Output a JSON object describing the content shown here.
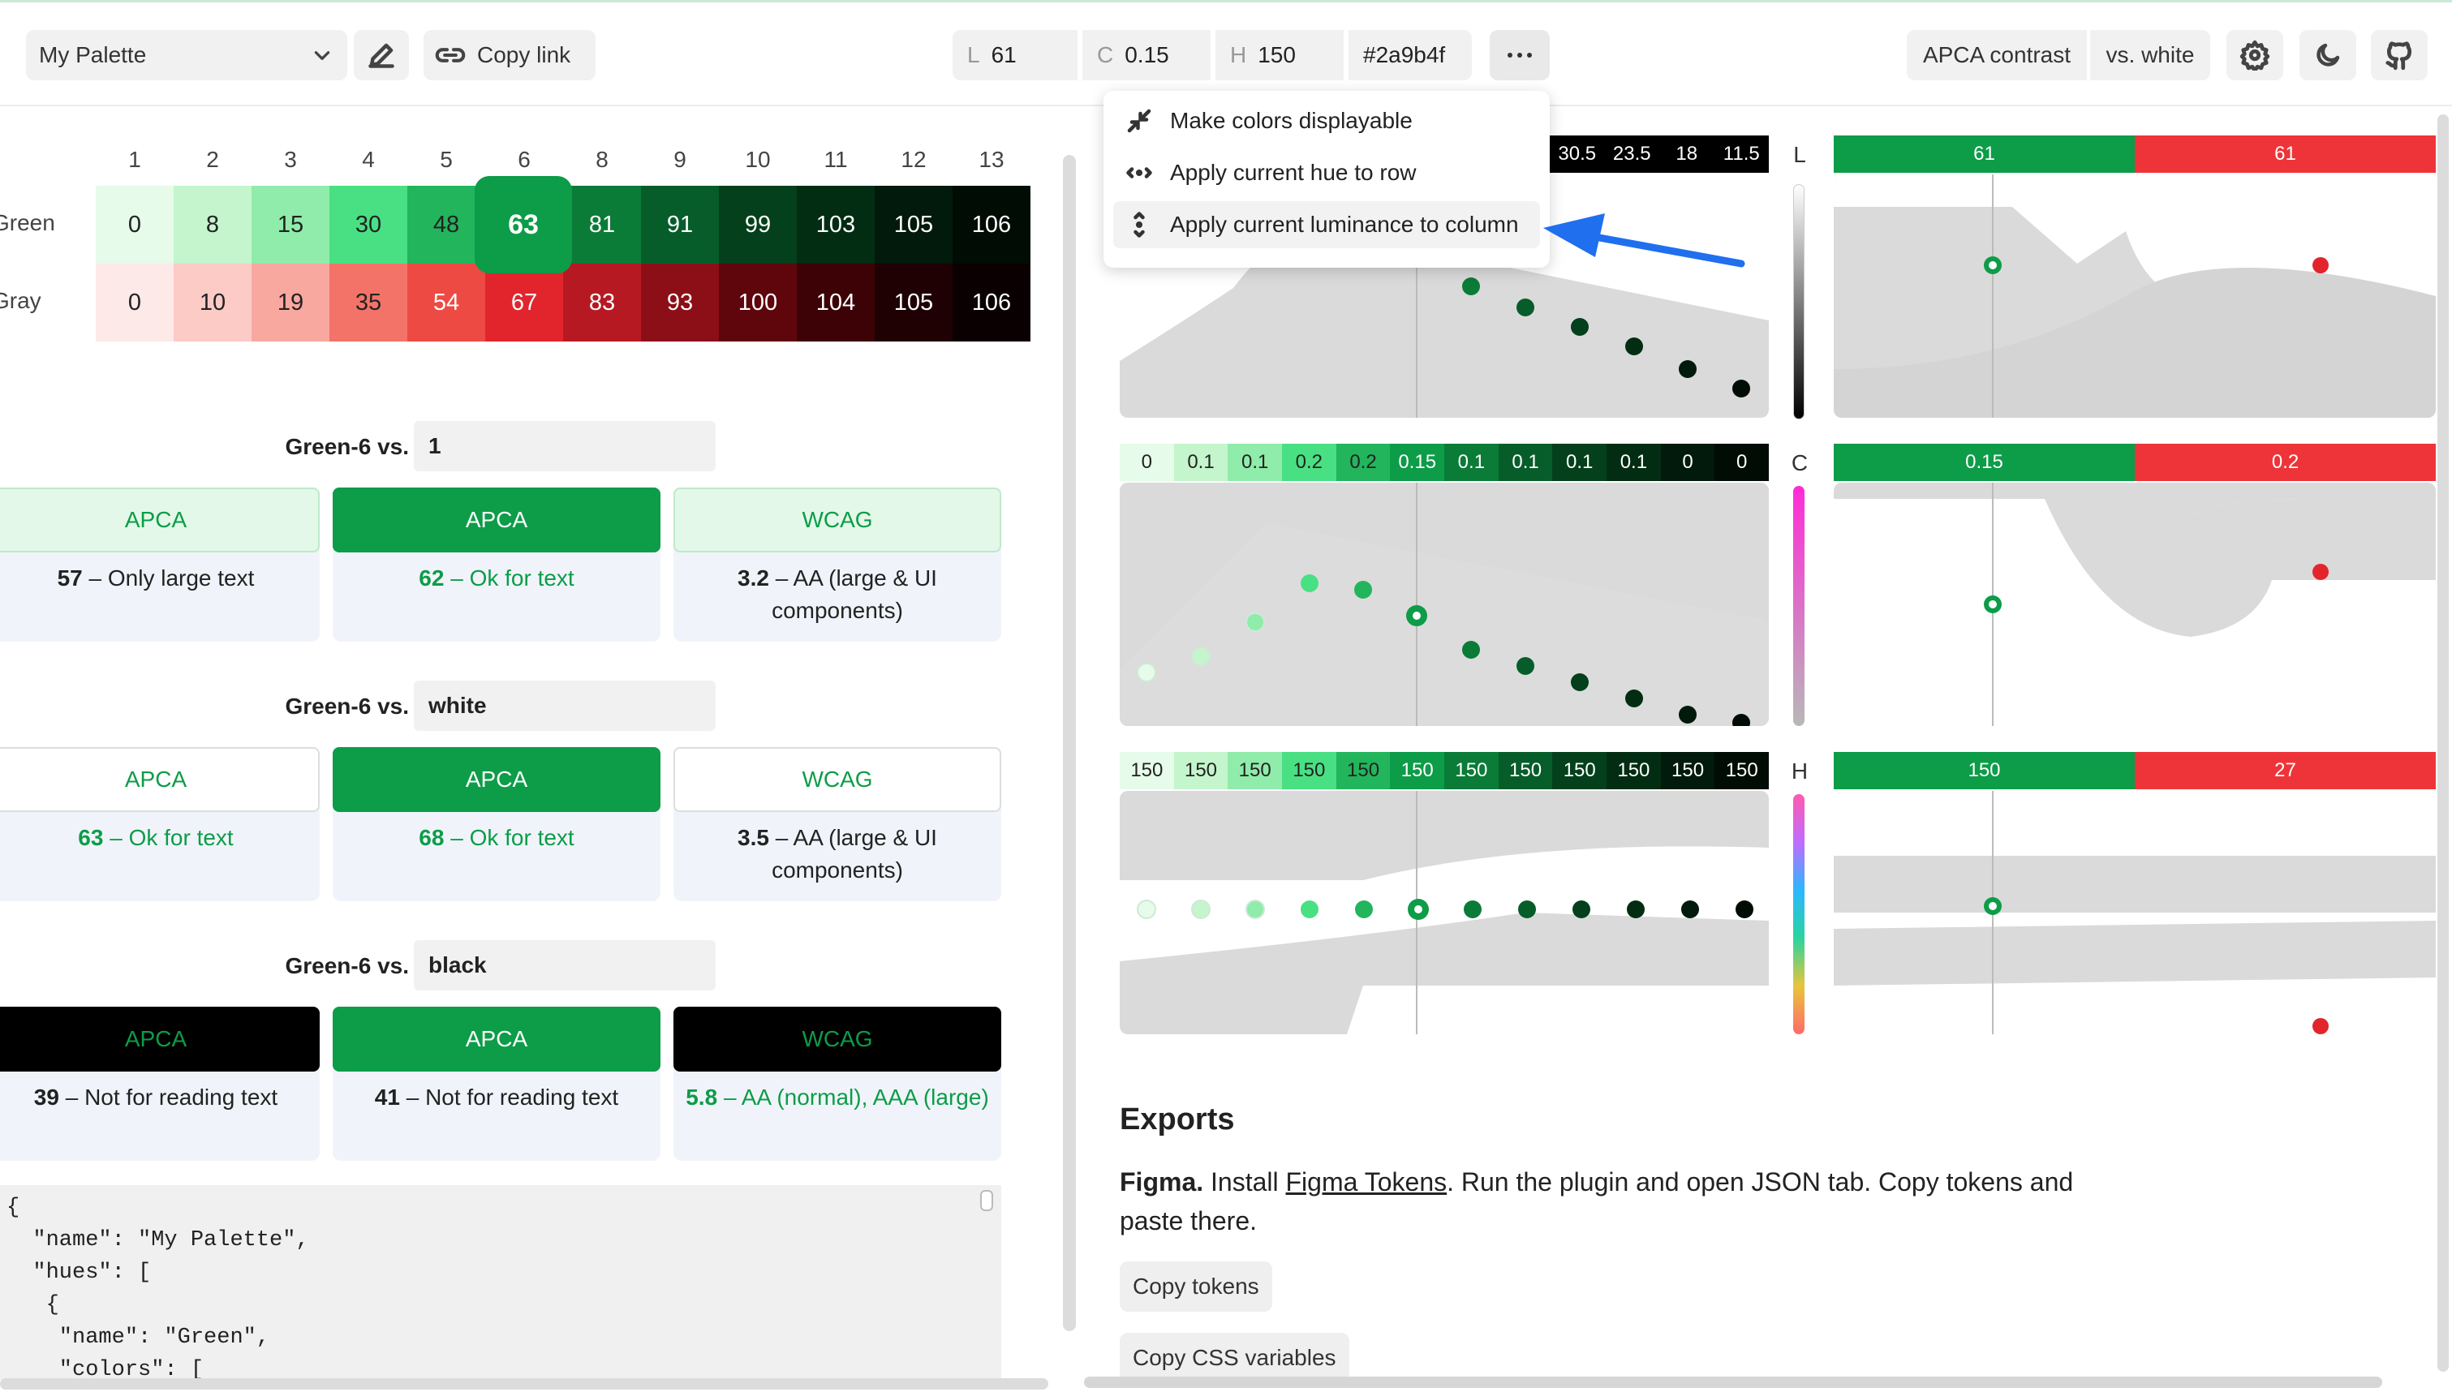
{
  "toolbar": {
    "palette_name": "My Palette",
    "copy_link": "Copy link",
    "l_key": "L",
    "l_val": "61",
    "c_key": "C",
    "c_val": "0.15",
    "h_key": "H",
    "h_val": "150",
    "hex": "#2a9b4f",
    "apca_contrast": "APCA contrast",
    "vs_white": "vs. white"
  },
  "menu": {
    "items": [
      "Make colors displayable",
      "Apply current hue to row",
      "Apply current luminance to column"
    ]
  },
  "grid": {
    "columns": [
      "1",
      "2",
      "3",
      "4",
      "5",
      "6",
      "8",
      "9",
      "10",
      "11",
      "12",
      "13"
    ],
    "rows": [
      {
        "name": "Green",
        "values": [
          "0",
          "8",
          "15",
          "30",
          "48",
          "63",
          "81",
          "91",
          "99",
          "103",
          "105",
          "106"
        ],
        "colors": [
          "#e6fbe9",
          "#c4f5cc",
          "#8fecaa",
          "#49e083",
          "#22b55c",
          "#0d9c48",
          "#0b7b38",
          "#075d2a",
          "#03401b",
          "#022d12",
          "#011a0b",
          "#000c04"
        ],
        "text": [
          "#222",
          "#222",
          "#222",
          "#222",
          "#222",
          "#fff",
          "#fff",
          "#fff",
          "#fff",
          "#fff",
          "#fff",
          "#fff"
        ]
      },
      {
        "name": "Gray",
        "values": [
          "0",
          "10",
          "19",
          "35",
          "54",
          "67",
          "83",
          "93",
          "100",
          "104",
          "105",
          "106"
        ],
        "colors": [
          "#fde9e7",
          "#fccbc6",
          "#f9a8a0",
          "#f47368",
          "#ee4a44",
          "#e2252c",
          "#b71922",
          "#8c0e16",
          "#5f060c",
          "#3c0206",
          "#1f0103",
          "#0a0001"
        ],
        "text": [
          "#222",
          "#222",
          "#222",
          "#222",
          "#fff",
          "#fff",
          "#fff",
          "#fff",
          "#fff",
          "#fff",
          "#fff",
          "#fff"
        ]
      }
    ]
  },
  "comparisons": [
    {
      "label": "Green-6 vs.",
      "target": "1",
      "cards": [
        {
          "head": "APCA",
          "num": "57",
          "desc": " – Only large text"
        },
        {
          "head": "APCA",
          "num": "62",
          "desc": " – Ok for text"
        },
        {
          "head": "WCAG",
          "num": "3.2",
          "desc": " – AA (large & UI components)"
        }
      ]
    },
    {
      "label": "Green-6 vs.",
      "target": "white",
      "cards": [
        {
          "head": "APCA",
          "num": "63",
          "desc": " – Ok for text"
        },
        {
          "head": "APCA",
          "num": "68",
          "desc": " – Ok for text"
        },
        {
          "head": "WCAG",
          "num": "3.5",
          "desc": " – AA (large & UI components)"
        }
      ]
    },
    {
      "label": "Green-6 vs.",
      "target": "black",
      "cards": [
        {
          "head": "APCA",
          "num": "39",
          "desc": " – Not for reading text"
        },
        {
          "head": "APCA",
          "num": "41",
          "desc": " – Not for reading text"
        },
        {
          "head": "WCAG",
          "num": "5.8",
          "desc": " – AA (normal), AAA (large)"
        }
      ]
    }
  ],
  "code": "{\n  \"name\": \"My Palette\",\n  \"hues\": [\n   {\n    \"name\": \"Green\",\n    \"colors\": [",
  "charts": {
    "l_bar": [
      "30.5",
      "23.5",
      "18",
      "11.5"
    ],
    "l_axis": "L",
    "c_bar": [
      "0",
      "0.1",
      "0.1",
      "0.2",
      "0.2",
      "0.15",
      "0.1",
      "0.1",
      "0.1",
      "0.1",
      "0",
      "0"
    ],
    "c_axis": "C",
    "h_bar": [
      "150",
      "150",
      "150",
      "150",
      "150",
      "150",
      "150",
      "150",
      "150",
      "150",
      "150",
      "150"
    ],
    "h_axis": "H",
    "l_right": [
      "61",
      "61"
    ],
    "c_right": [
      "0.15",
      "0.2"
    ],
    "h_right": [
      "150",
      "27"
    ]
  },
  "exports": {
    "title": "Exports",
    "figma_bold": "Figma.",
    "figma_pre": " Install ",
    "figma_link": "Figma Tokens",
    "figma_post": ". Run the plugin and open JSON tab. Copy tokens and paste there.",
    "copy_tokens": "Copy tokens",
    "copy_css": "Copy CSS variables"
  },
  "colors": {
    "accent": "#0d9c48",
    "red": "#e2252c",
    "arrow": "#1f6fef"
  }
}
